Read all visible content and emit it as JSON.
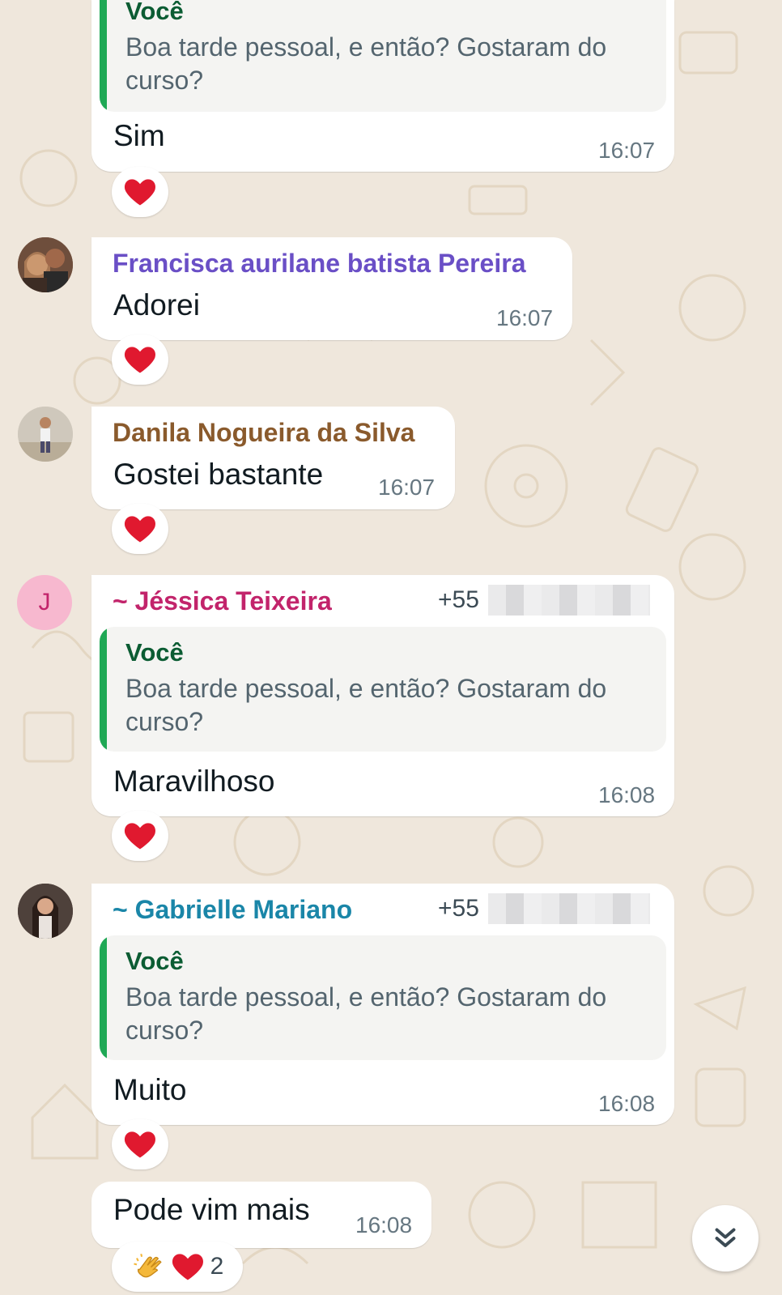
{
  "colors": {
    "background": "#efe7dc",
    "quote_bar": "#1fa855",
    "quote_name": "#0b5c33",
    "francisca": "#6a4fc6",
    "danila": "#8a5a2c",
    "jessica": "#c2246b",
    "gabrielle": "#1a86a8",
    "heart": "#e0192f"
  },
  "messages": [
    {
      "quote": {
        "author": "Você",
        "text": "Boa tarde pessoal, e então?  Gostaram do curso?"
      },
      "text": "Sim",
      "time": "16:07",
      "reaction": "heart-icon"
    },
    {
      "sender": "Francisca aurilane batista Pereira",
      "text": "Adorei",
      "time": "16:07",
      "reaction": "heart-icon"
    },
    {
      "sender": "Danila Nogueira da Silva",
      "text": "Gostei bastante",
      "time": "16:07",
      "reaction": "heart-icon"
    },
    {
      "sender": "~ Jéssica Teixeira",
      "avatar_letter": "J",
      "phone": "+55",
      "quote": {
        "author": "Você",
        "text": "Boa tarde pessoal, e então?  Gostaram do curso?"
      },
      "text": "Maravilhoso",
      "time": "16:08",
      "reaction": "heart-icon"
    },
    {
      "sender": "~ Gabrielle Mariano",
      "phone": "+55",
      "quote": {
        "author": "Você",
        "text": "Boa tarde pessoal, e então?  Gostaram do curso?"
      },
      "text": "Muito",
      "time": "16:08",
      "reaction": "heart-icon"
    },
    {
      "text": "Pode vim mais",
      "time": "16:08",
      "reactions": [
        "clapping-hands-icon",
        "heart-icon"
      ],
      "reaction_count": "2"
    }
  ],
  "scroll_button_icon": "double-chevron-down-icon"
}
